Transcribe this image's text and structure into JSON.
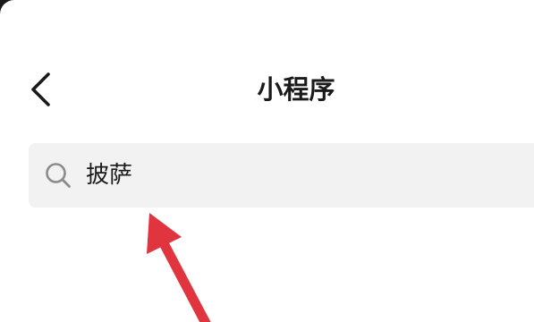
{
  "header": {
    "title": "小程序",
    "back_icon": "chevron-left-icon"
  },
  "search": {
    "value": "披萨",
    "icon": "search-icon"
  },
  "annotation": {
    "arrow_color": "#e0343f"
  },
  "colors": {
    "background": "#ffffff",
    "search_background": "#f2f2f2",
    "text": "#1a1a1a",
    "icon": "#8c8c8c"
  }
}
